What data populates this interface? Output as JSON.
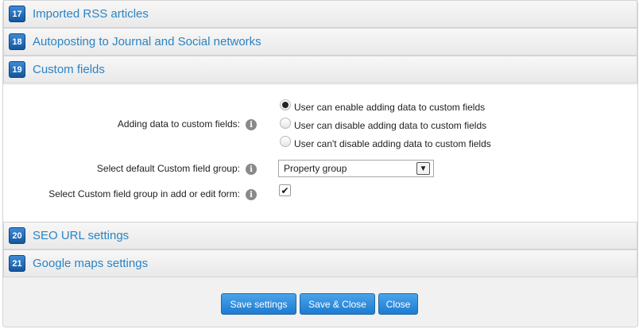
{
  "sections": {
    "s17": {
      "number": "17",
      "title": "Imported RSS articles"
    },
    "s18": {
      "number": "18",
      "title": "Autoposting to Journal and Social networks"
    },
    "s19": {
      "number": "19",
      "title": "Custom fields"
    },
    "s20": {
      "number": "20",
      "title": "SEO URL settings"
    },
    "s21": {
      "number": "21",
      "title": "Google maps settings"
    }
  },
  "custom_fields": {
    "adding_data": {
      "label": "Adding data to custom fields:",
      "options": [
        {
          "label": "User can enable adding data to custom fields",
          "checked": true
        },
        {
          "label": "User can disable adding data to custom fields",
          "checked": false
        },
        {
          "label": "User can't disable adding data to custom fields",
          "checked": false
        }
      ]
    },
    "default_group": {
      "label": "Select default Custom field group:",
      "selected": "Property group"
    },
    "select_in_form": {
      "label": "Select Custom field group in add or edit form:",
      "checked": true
    }
  },
  "icons": {
    "info": "info-icon",
    "check": "checkmark-icon",
    "dropdown": "chevron-down-icon"
  },
  "glyphs": {
    "info": "i",
    "check": "✔",
    "dropdown": "▼"
  },
  "buttons": {
    "save": "Save settings",
    "save_close": "Save & Close",
    "close": "Close"
  },
  "colors": {
    "accent": "#2a84c4",
    "button": "#1d7bd0",
    "badge": "#14569d"
  }
}
